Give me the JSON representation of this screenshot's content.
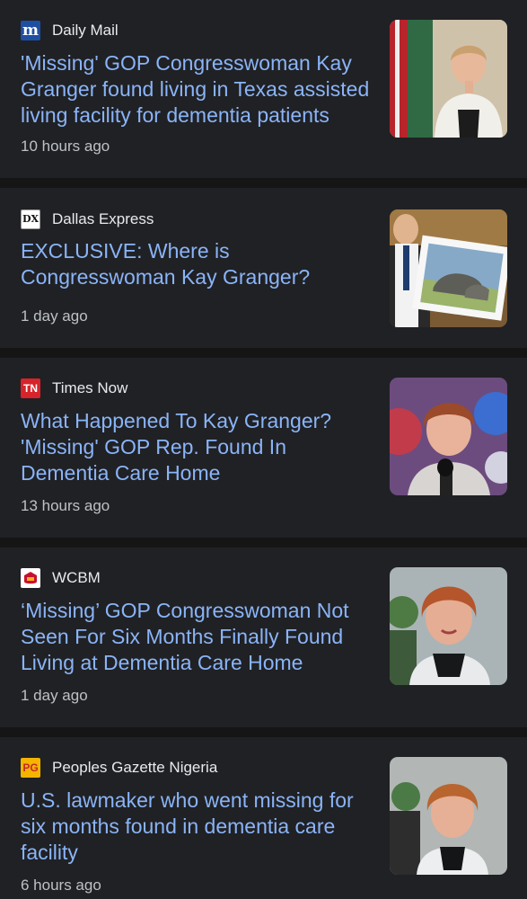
{
  "articles": [
    {
      "source": "Daily Mail",
      "source_icon": "daily-mail-logo-icon",
      "headline": "'Missing' GOP Congresswoman Kay Granger found living in Texas assisted living facility for dementia patients",
      "time": "10 hours ago",
      "thumbnail": "woman-at-podium-photo"
    },
    {
      "source": "Dallas Express",
      "source_icon": "dallas-express-logo-icon",
      "headline": "EXCLUSIVE: Where is Congresswoman Kay Granger?",
      "time": "1 day ago",
      "thumbnail": "man-holding-rhino-picture-photo"
    },
    {
      "source": "Times Now",
      "source_icon": "times-now-logo-icon",
      "headline": "What Happened To Kay Granger? 'Missing' GOP Rep. Found In Dementia Care Home",
      "time": "13 hours ago",
      "thumbnail": "woman-speaking-microphone-photo"
    },
    {
      "source": "WCBM",
      "source_icon": "wcbm-logo-icon",
      "headline": "‘Missing’ GOP Congresswoman Not Seen For Six Months Finally Found Living at Dementia Care Home",
      "time": "1 day ago",
      "thumbnail": "woman-portrait-photo"
    },
    {
      "source": "Peoples Gazette Nigeria",
      "source_icon": "peoples-gazette-logo-icon",
      "headline": "U.S. lawmaker who went missing for six months found in dementia care facility",
      "time": "6 hours ago",
      "thumbnail": "woman-interview-photo"
    }
  ],
  "logo_text": {
    "daily_mail": "m",
    "dallas_express": "DX",
    "times_now": "TN",
    "peoples_gazette": "PG"
  },
  "colors": {
    "background": "#151516",
    "card": "#202124",
    "headline": "#8ab4f8",
    "source_text": "#e8eaed",
    "time_text": "#bdc1c6"
  }
}
